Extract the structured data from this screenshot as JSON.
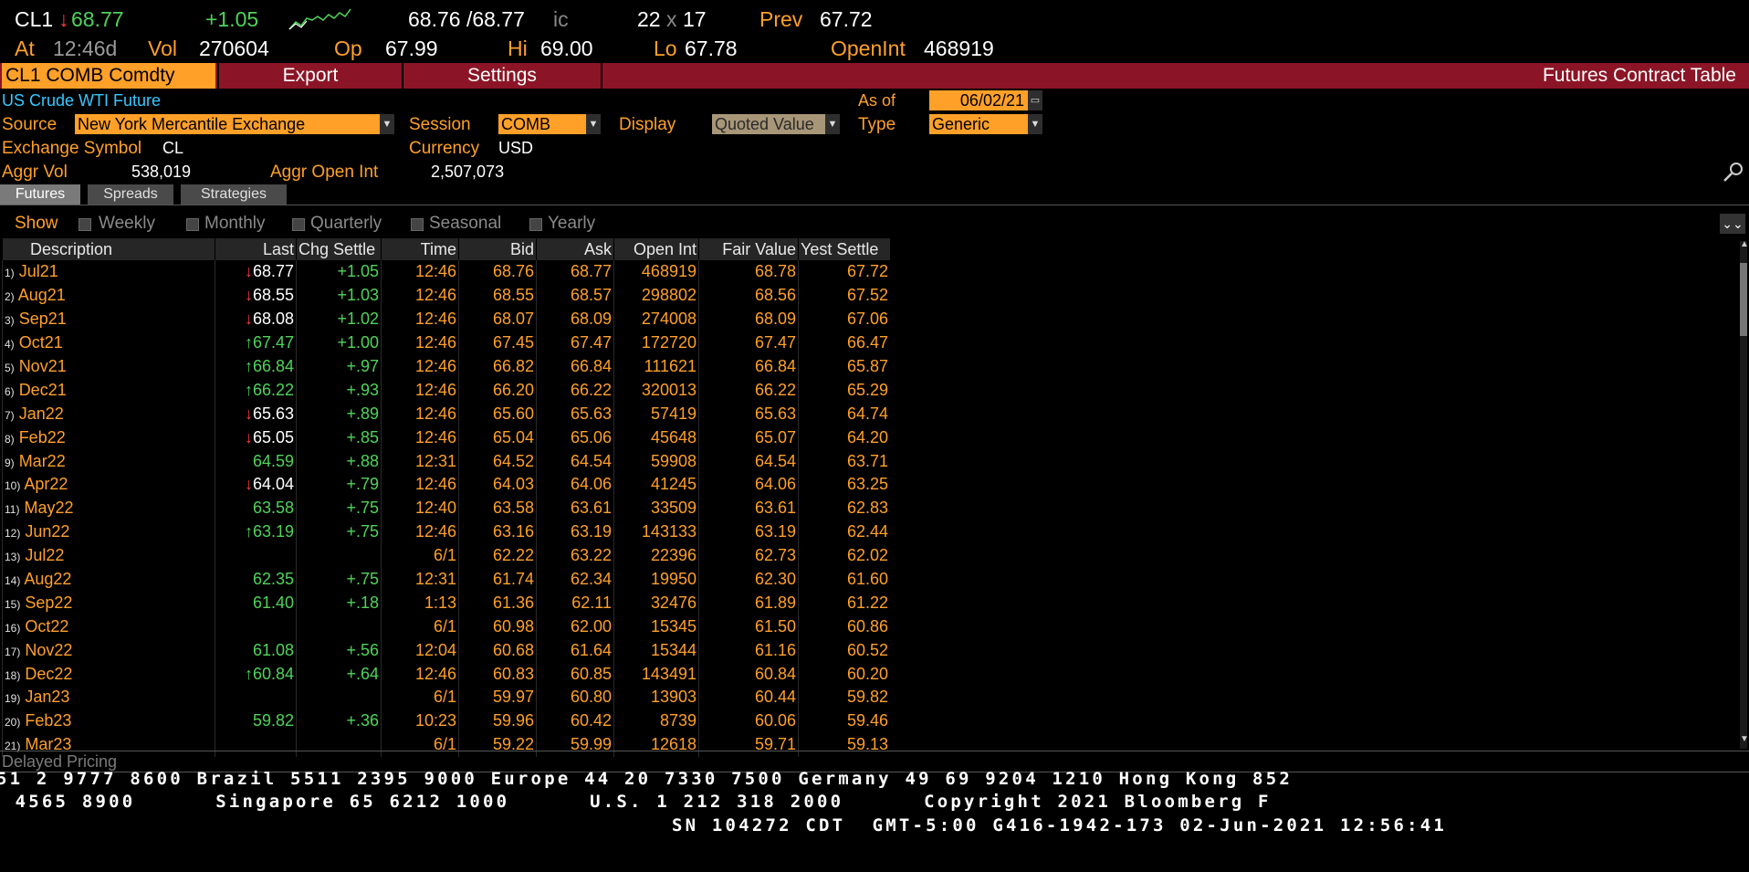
{
  "quote": {
    "ticker": "CL1",
    "last": "68.77",
    "change": "+1.05",
    "bid_ask": "68.76 /68.77",
    "bid_ask_suffix": "ic",
    "size": "22",
    "size_sep": "x",
    "size2": "17",
    "prev_label": "Prev",
    "prev": "67.72",
    "at_label": "At",
    "time": "12:46d",
    "vol_label": "Vol",
    "vol": "270604",
    "op_label": "Op",
    "open": "67.99",
    "hi_label": "Hi",
    "hi": "69.00",
    "lo_label": "Lo",
    "lo": "67.78",
    "openint_label": "OpenInt",
    "openint": "468919"
  },
  "toolbar": {
    "security": "CL1 COMB Comdty",
    "export": "Export",
    "settings": "Settings",
    "title": "Futures Contract Table"
  },
  "info": {
    "name": "US Crude WTI Future",
    "source_label": "Source",
    "source": "New York Mercantile Exchange",
    "session_label": "Session",
    "session": "COMB",
    "display_label": "Display",
    "display": "Quoted Value",
    "asof_label": "As of",
    "asof": "06/02/21",
    "type_label": "Type",
    "type": "Generic",
    "exch_label": "Exchange Symbol",
    "exch": "CL",
    "currency_label": "Currency",
    "currency": "USD",
    "aggvol_label": "Aggr Vol",
    "aggvol": "538,019",
    "aggoi_label": "Aggr Open Int",
    "aggoi": "2,507,073"
  },
  "tabs": [
    "Futures",
    "Spreads",
    "Strategies"
  ],
  "show": {
    "label": "Show",
    "options": [
      "Weekly",
      "Monthly",
      "Quarterly",
      "Seasonal",
      "Yearly"
    ]
  },
  "table": {
    "columns": [
      "Description",
      "Last",
      "Chg",
      "Settle",
      "Time",
      "Bid",
      "Ask",
      "Open Int",
      "Fair Value",
      "Yest",
      "Settle"
    ],
    "rows": [
      {
        "n": "1)",
        "d": "Jul21",
        "ar": "down",
        "last": "68.77",
        "chg": "+1.05",
        "time": "12:46",
        "bid": "68.76",
        "ask": "68.77",
        "oi": "468919",
        "fv": "68.78",
        "ys": "67.72"
      },
      {
        "n": "2)",
        "d": "Aug21",
        "ar": "down",
        "last": "68.55",
        "chg": "+1.03",
        "time": "12:46",
        "bid": "68.55",
        "ask": "68.57",
        "oi": "298802",
        "fv": "68.56",
        "ys": "67.52"
      },
      {
        "n": "3)",
        "d": "Sep21",
        "ar": "down",
        "last": "68.08",
        "chg": "+1.02",
        "time": "12:46",
        "bid": "68.07",
        "ask": "68.09",
        "oi": "274008",
        "fv": "68.09",
        "ys": "67.06"
      },
      {
        "n": "4)",
        "d": "Oct21",
        "ar": "up",
        "last": "67.47",
        "chg": "+1.00",
        "time": "12:46",
        "bid": "67.45",
        "ask": "67.47",
        "oi": "172720",
        "fv": "67.47",
        "ys": "66.47"
      },
      {
        "n": "5)",
        "d": "Nov21",
        "ar": "up",
        "last": "66.84",
        "chg": "+.97",
        "time": "12:46",
        "bid": "66.82",
        "ask": "66.84",
        "oi": "111621",
        "fv": "66.84",
        "ys": "65.87"
      },
      {
        "n": "6)",
        "d": "Dec21",
        "ar": "up",
        "last": "66.22",
        "chg": "+.93",
        "time": "12:46",
        "bid": "66.20",
        "ask": "66.22",
        "oi": "320013",
        "fv": "66.22",
        "ys": "65.29"
      },
      {
        "n": "7)",
        "d": "Jan22",
        "ar": "down",
        "last": "65.63",
        "chg": "+.89",
        "time": "12:46",
        "bid": "65.60",
        "ask": "65.63",
        "oi": "57419",
        "fv": "65.63",
        "ys": "64.74"
      },
      {
        "n": "8)",
        "d": "Feb22",
        "ar": "down",
        "last": "65.05",
        "chg": "+.85",
        "time": "12:46",
        "bid": "65.04",
        "ask": "65.06",
        "oi": "45648",
        "fv": "65.07",
        "ys": "64.20"
      },
      {
        "n": "9)",
        "d": "Mar22",
        "ar": "",
        "last": "64.59",
        "chg": "+.88",
        "time": "12:31",
        "bid": "64.52",
        "ask": "64.54",
        "oi": "59908",
        "fv": "64.54",
        "ys": "63.71"
      },
      {
        "n": "10)",
        "d": "Apr22",
        "ar": "down",
        "last": "64.04",
        "chg": "+.79",
        "time": "12:46",
        "bid": "64.03",
        "ask": "64.06",
        "oi": "41245",
        "fv": "64.06",
        "ys": "63.25"
      },
      {
        "n": "11)",
        "d": "May22",
        "ar": "",
        "last": "63.58",
        "chg": "+.75",
        "time": "12:40",
        "bid": "63.58",
        "ask": "63.61",
        "oi": "33509",
        "fv": "63.61",
        "ys": "62.83"
      },
      {
        "n": "12)",
        "d": "Jun22",
        "ar": "up",
        "last": "63.19",
        "chg": "+.75",
        "time": "12:46",
        "bid": "63.16",
        "ask": "63.19",
        "oi": "143133",
        "fv": "63.19",
        "ys": "62.44"
      },
      {
        "n": "13)",
        "d": "Jul22",
        "ar": "",
        "last": "",
        "chg": "",
        "time": "6/1",
        "bid": "62.22",
        "ask": "63.22",
        "oi": "22396",
        "fv": "62.73",
        "ys": "62.02"
      },
      {
        "n": "14)",
        "d": "Aug22",
        "ar": "",
        "last": "62.35",
        "chg": "+.75",
        "time": "12:31",
        "bid": "61.74",
        "ask": "62.34",
        "oi": "19950",
        "fv": "62.30",
        "ys": "61.60"
      },
      {
        "n": "15)",
        "d": "Sep22",
        "ar": "",
        "last": "61.40",
        "chg": "+.18",
        "time": "1:13",
        "bid": "61.36",
        "ask": "62.11",
        "oi": "32476",
        "fv": "61.89",
        "ys": "61.22"
      },
      {
        "n": "16)",
        "d": "Oct22",
        "ar": "",
        "last": "",
        "chg": "",
        "time": "6/1",
        "bid": "60.98",
        "ask": "62.00",
        "oi": "15345",
        "fv": "61.50",
        "ys": "60.86"
      },
      {
        "n": "17)",
        "d": "Nov22",
        "ar": "",
        "last": "61.08",
        "chg": "+.56",
        "time": "12:04",
        "bid": "60.68",
        "ask": "61.64",
        "oi": "15344",
        "fv": "61.16",
        "ys": "60.52"
      },
      {
        "n": "18)",
        "d": "Dec22",
        "ar": "up",
        "last": "60.84",
        "chg": "+.64",
        "time": "12:46",
        "bid": "60.83",
        "ask": "60.85",
        "oi": "143491",
        "fv": "60.84",
        "ys": "60.20"
      },
      {
        "n": "19)",
        "d": "Jan23",
        "ar": "",
        "last": "",
        "chg": "",
        "time": "6/1",
        "bid": "59.97",
        "ask": "60.80",
        "oi": "13903",
        "fv": "60.44",
        "ys": "59.82"
      },
      {
        "n": "20)",
        "d": "Feb23",
        "ar": "",
        "last": "59.82",
        "chg": "+.36",
        "time": "10:23",
        "bid": "59.96",
        "ask": "60.42",
        "oi": "8739",
        "fv": "60.06",
        "ys": "59.46"
      },
      {
        "n": "21)",
        "d": "Mar23",
        "ar": "",
        "last": "",
        "chg": "",
        "time": "6/1",
        "bid": "59.22",
        "ask": "59.99",
        "oi": "12618",
        "fv": "59.71",
        "ys": "59.13"
      }
    ]
  },
  "footer": {
    "delayed": "Delayed Pricing",
    "line1": "51 2 9777 8600 Brazil 5511 2395 9000 Europe 44 20 7330 7500 Germany 49 69 9204 1210 Hong Kong 852",
    "line2": " 4565 8900      Singapore 65 6212 1000      U.S. 1 212 318 2000      Copyright 2021 Bloomberg F",
    "line3": "SN 104272 CDT  GMT-5:00 G416-1942-173 02-Jun-2021 12:56:41"
  },
  "colors": {
    "orange": "#ffa028",
    "red_bar": "#8b1526",
    "green": "#4fd35a",
    "red": "#ff3b3b",
    "cyan": "#38c8ff"
  }
}
